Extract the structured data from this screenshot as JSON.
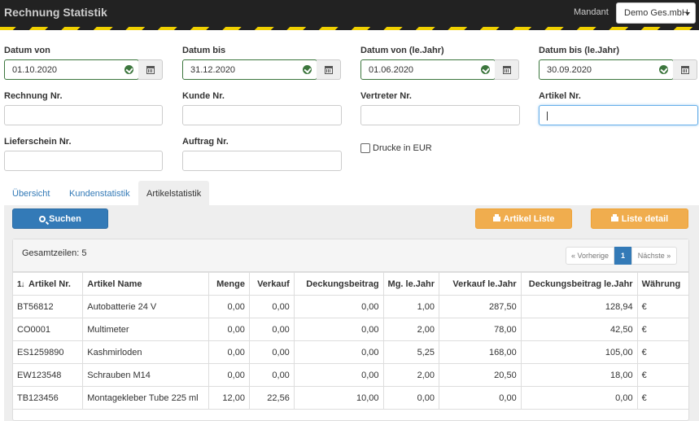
{
  "app": {
    "title": "Rechnung Statistik",
    "mandant_label": "Mandant",
    "mandant_value": "Demo Ges.mbH"
  },
  "filters": {
    "datum_von": {
      "label": "Datum von",
      "value": "01.10.2020"
    },
    "datum_bis": {
      "label": "Datum bis",
      "value": "31.12.2020"
    },
    "datum_von_vj": {
      "label": "Datum von (le.Jahr)",
      "value": "01.06.2020"
    },
    "datum_bis_vj": {
      "label": "Datum bis (le.Jahr)",
      "value": "30.09.2020"
    },
    "rechnung_nr": {
      "label": "Rechnung Nr.",
      "value": ""
    },
    "kunde_nr": {
      "label": "Kunde Nr.",
      "value": ""
    },
    "vertreter_nr": {
      "label": "Vertreter Nr.",
      "value": ""
    },
    "artikel_nr": {
      "label": "Artikel Nr.",
      "value": ""
    },
    "lieferschein_nr": {
      "label": "Lieferschein Nr.",
      "value": ""
    },
    "auftrag_nr": {
      "label": "Auftrag Nr.",
      "value": ""
    },
    "drucke_eur": {
      "label": "Drucke in EUR",
      "checked": false
    }
  },
  "tabs": [
    {
      "label": "Übersicht",
      "active": false
    },
    {
      "label": "Kundenstatistik",
      "active": false
    },
    {
      "label": "Artikelstatistik",
      "active": true
    }
  ],
  "buttons": {
    "search": "Suchen",
    "artikel_liste": "Artikel Liste",
    "liste_detail": "Liste detail"
  },
  "results": {
    "total_label": "Gesamtzeilen: 5",
    "pagination": {
      "prev": "« Vorherige",
      "current": "1",
      "next": "Nächste »"
    },
    "sort_icon": "1↓",
    "columns": [
      "Artikel Nr.",
      "Artikel Name",
      "Menge",
      "Verkauf",
      "Deckungsbeitrag",
      "Mg. le.Jahr",
      "Verkauf le.Jahr",
      "Deckungsbeitrag le.Jahr",
      "Währung"
    ],
    "rows": [
      [
        "BT56812",
        "Autobatterie 24 V",
        "0,00",
        "0,00",
        "0,00",
        "1,00",
        "287,50",
        "128,94",
        "€"
      ],
      [
        "CO0001",
        "Multimeter",
        "0,00",
        "0,00",
        "0,00",
        "2,00",
        "78,00",
        "42,50",
        "€"
      ],
      [
        "ES1259890",
        "Kashmirloden",
        "0,00",
        "0,00",
        "0,00",
        "5,25",
        "168,00",
        "105,00",
        "€"
      ],
      [
        "EW123548",
        "Schrauben M14",
        "0,00",
        "0,00",
        "0,00",
        "2,00",
        "20,50",
        "18,00",
        "€"
      ],
      [
        "TB123456",
        "Montagekleber Tube 225 ml",
        "12,00",
        "22,56",
        "10,00",
        "0,00",
        "0,00",
        "0,00",
        "€"
      ]
    ]
  },
  "colors": {
    "primary": "#337ab7",
    "warning": "#f0ad4e",
    "success": "#3c763d",
    "topbar": "#222222",
    "stripe": "#f0d000"
  }
}
